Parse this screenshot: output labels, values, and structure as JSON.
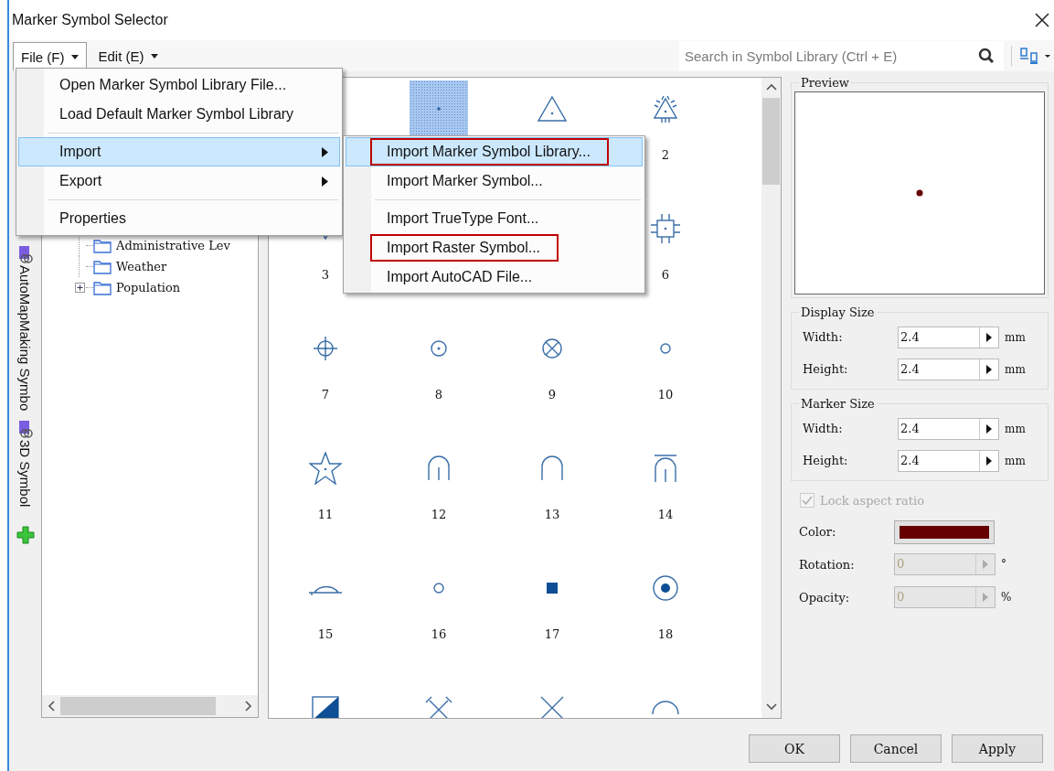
{
  "window": {
    "title": "Marker Symbol Selector"
  },
  "menu_bar": [
    {
      "label": "File (F)",
      "open": true
    },
    {
      "label": "Edit (E)",
      "open": false
    }
  ],
  "search": {
    "placeholder": "Search in Symbol Library (Ctrl + E)"
  },
  "side_tabs": [
    {
      "kind": "tab",
      "label": "AutoMapMaking Symbo"
    },
    {
      "kind": "tab",
      "label": "3D Symbol"
    },
    {
      "kind": "add"
    }
  ],
  "tree": {
    "items": [
      {
        "label": "Administrative Lev"
      },
      {
        "label": "Weather"
      },
      {
        "label": "Population",
        "expanded": false
      }
    ]
  },
  "symbols": [
    {
      "kind": "hidden"
    },
    {
      "kind": "dot",
      "selected": true
    },
    {
      "kind": "triangle",
      "selected": false
    },
    {
      "kind": "triangle-ticks",
      "label": "2",
      "selected": false
    },
    {
      "kind": "triangle-down",
      "label": "3",
      "selected": false
    },
    {
      "kind": "hidden"
    },
    {
      "kind": "hidden"
    },
    {
      "kind": "chip",
      "label": "6",
      "selected": false
    },
    {
      "kind": "crosshair",
      "label": "7",
      "selected": false
    },
    {
      "kind": "circle-dot",
      "label": "8",
      "selected": false
    },
    {
      "kind": "circle-x",
      "label": "9",
      "selected": false
    },
    {
      "kind": "small-circle",
      "label": "10",
      "selected": false
    },
    {
      "kind": "star",
      "label": "11",
      "selected": false
    },
    {
      "kind": "arch-line",
      "label": "12",
      "selected": false
    },
    {
      "kind": "arch",
      "label": "13",
      "selected": false
    },
    {
      "kind": "arch-bar",
      "label": "14",
      "selected": false
    },
    {
      "kind": "half-circle",
      "label": "15",
      "selected": false
    },
    {
      "kind": "small-circle",
      "label": "16",
      "selected": false
    },
    {
      "kind": "square",
      "label": "17",
      "selected": false
    },
    {
      "kind": "target",
      "label": "18",
      "selected": false
    },
    {
      "kind": "half-square",
      "selected": false
    },
    {
      "kind": "cross-ticks",
      "selected": false
    },
    {
      "kind": "x-cross",
      "selected": false
    },
    {
      "kind": "arc",
      "selected": false
    }
  ],
  "preview": {
    "title": "Preview"
  },
  "display_size": {
    "title": "Display Size",
    "fields": [
      {
        "label": "Width:",
        "value": "2.4",
        "unit": "mm",
        "disabled": false
      },
      {
        "label": "Height:",
        "value": "2.4",
        "unit": "mm",
        "disabled": false
      }
    ]
  },
  "marker_size": {
    "title": "Marker Size",
    "fields": [
      {
        "label": "Width:",
        "value": "2.4",
        "unit": "mm",
        "disabled": false
      },
      {
        "label": "Height:",
        "value": "2.4",
        "unit": "mm",
        "disabled": false
      }
    ]
  },
  "lock_aspect_ratio": {
    "label": "Lock aspect ratio",
    "checked": true,
    "disabled": true
  },
  "color": {
    "label": "Color:",
    "color": "#660000"
  },
  "extra_fields": [
    {
      "label": "Rotation:",
      "value": "0",
      "unit": "°",
      "disabled": true
    },
    {
      "label": "Opacity:",
      "value": "0",
      "unit": "%",
      "disabled": true
    }
  ],
  "buttons": [
    "OK",
    "Cancel",
    "Apply"
  ],
  "file_menu": {
    "items": [
      {
        "kind": "item",
        "label": "Open Marker Symbol Library File...",
        "highlighted": false,
        "submenu": false
      },
      {
        "kind": "item",
        "label": "Load Default Marker Symbol Library",
        "highlighted": false,
        "submenu": false
      },
      {
        "kind": "separator"
      },
      {
        "kind": "item",
        "label": "Import",
        "highlighted": true,
        "submenu": true
      },
      {
        "kind": "item",
        "label": "Export",
        "highlighted": false,
        "submenu": true
      },
      {
        "kind": "separator"
      },
      {
        "kind": "item",
        "label": "Properties",
        "highlighted": false,
        "submenu": false
      }
    ]
  },
  "import_submenu": {
    "items": [
      {
        "kind": "item",
        "label": "Import Marker Symbol Library...",
        "highlighted": true,
        "outlined": true
      },
      {
        "kind": "item",
        "label": "Import Marker Symbol...",
        "highlighted": false,
        "outlined": false
      },
      {
        "kind": "separator"
      },
      {
        "kind": "item",
        "label": "Import TrueType Font...",
        "highlighted": false,
        "outlined": false
      },
      {
        "kind": "item",
        "label": "Import Raster Symbol...",
        "highlighted": false,
        "outlined": true
      },
      {
        "kind": "item",
        "label": "Import AutoCAD File...",
        "highlighted": false,
        "outlined": false
      }
    ]
  }
}
